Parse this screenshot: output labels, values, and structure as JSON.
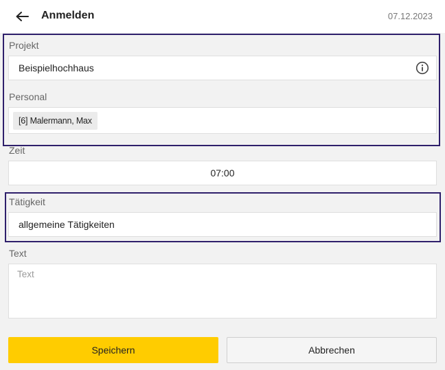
{
  "header": {
    "title": "Anmelden",
    "date": "07.12.2023",
    "back_icon": "arrow-left-icon"
  },
  "form": {
    "projekt": {
      "label": "Projekt",
      "value": "Beispielhochhaus",
      "icon": "info-icon"
    },
    "personal": {
      "label": "Personal",
      "chips": [
        "[6] Malermann, Max"
      ]
    },
    "zeit": {
      "label": "Zeit",
      "value": "07:00"
    },
    "taetigkeit": {
      "label": "Tätigkeit",
      "value": "allgemeine Tätigkeiten"
    },
    "text": {
      "label": "Text",
      "value": "",
      "placeholder": "Text"
    }
  },
  "actions": {
    "save_label": "Speichern",
    "cancel_label": "Abbrechen"
  },
  "colors": {
    "accent": "#ffcc00",
    "highlight": "#2e1f6b"
  }
}
